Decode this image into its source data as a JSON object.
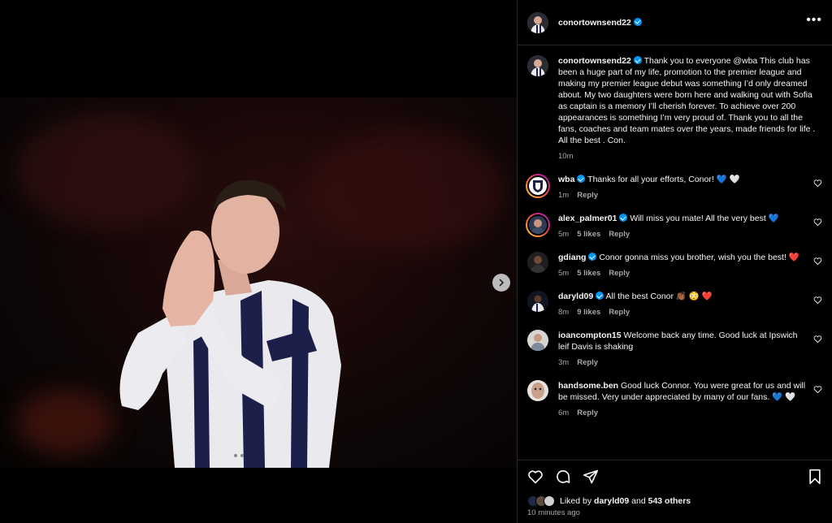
{
  "post": {
    "username": "conortownsend22",
    "more_label": "•••",
    "carousel_dots": 3,
    "caption": {
      "username": "conortownsend22",
      "text": "Thank you to everyone @wba This club has been a huge part of my life, promotion to the premier league and making my premier league debut was something I’d only dreamed about. My two daughters were born here and walking out with Sofia as captain is a memory I’ll cherish forever. To achieve over 200 appearances is something I’m very proud of. Thank you to all the fans, coaches and team mates over the years, made friends for life . All the best . Con.",
      "time": "10m"
    }
  },
  "comments": [
    {
      "username": "wba",
      "verified": true,
      "text": "Thanks for all your efforts, Conor! 💙 🤍",
      "time": "1m",
      "likes": "",
      "reply": "Reply"
    },
    {
      "username": "alex_palmer01",
      "verified": true,
      "text": "Will miss you mate! All the very best 💙",
      "time": "5m",
      "likes": "5 likes",
      "reply": "Reply"
    },
    {
      "username": "gdiang",
      "verified": true,
      "text": "Conor gonna miss you brother, wish you the best! ❤️",
      "time": "5m",
      "likes": "5 likes",
      "reply": "Reply"
    },
    {
      "username": "daryld09",
      "verified": true,
      "text": "All the best Conor 👏🏾 😳 ❤️",
      "time": "8m",
      "likes": "9 likes",
      "reply": "Reply"
    },
    {
      "username": "ioancompton15",
      "verified": false,
      "text": "Welcome back any time. Good luck at Ipswich leif Davis is shaking",
      "time": "3m",
      "likes": "",
      "reply": "Reply"
    },
    {
      "username": "handsome.ben",
      "verified": false,
      "text": "Good luck Connor. You were great for us and will be missed. Very under appreciated by many of our fans. 💙 🤍",
      "time": "6m",
      "likes": "",
      "reply": "Reply"
    }
  ],
  "likes": {
    "prefix": "Liked by",
    "user": "daryld09",
    "and": "and",
    "others": "543 others"
  },
  "time_ago": "10 minutes ago",
  "colors": {
    "accent": "#0095f6",
    "background": "#000000",
    "muted": "#a8a8a8",
    "border": "#262626"
  }
}
